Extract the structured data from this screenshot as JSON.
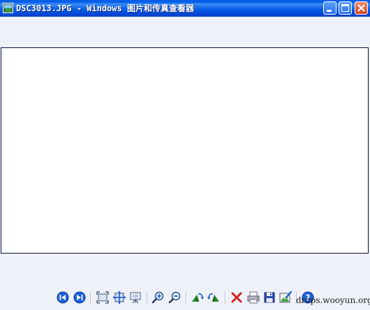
{
  "window": {
    "title": "DSC3013.JPG - Windows 图片和传真查看器"
  },
  "toolbar": {
    "buttons": [
      {
        "name": "previous-image",
        "icon": "previous-icon"
      },
      {
        "name": "next-image",
        "icon": "next-icon"
      },
      {
        "name": "best-fit",
        "icon": "best-fit-icon"
      },
      {
        "name": "actual-size",
        "icon": "actual-size-icon"
      },
      {
        "name": "slideshow",
        "icon": "slideshow-icon"
      },
      {
        "name": "zoom-in",
        "icon": "zoom-in-icon"
      },
      {
        "name": "zoom-out",
        "icon": "zoom-out-icon"
      },
      {
        "name": "rotate-clockwise",
        "icon": "rotate-clockwise-icon"
      },
      {
        "name": "rotate-counterclockwise",
        "icon": "rotate-counterclockwise-icon"
      },
      {
        "name": "delete",
        "icon": "delete-icon"
      },
      {
        "name": "print",
        "icon": "print-icon"
      },
      {
        "name": "save",
        "icon": "save-icon"
      },
      {
        "name": "edit",
        "icon": "edit-icon"
      },
      {
        "name": "help",
        "icon": "help-icon"
      }
    ]
  },
  "watermark": {
    "text": "drops.wooyun.org"
  },
  "colors": {
    "titlebar": "#0058e6",
    "content_bg": "#eef1f8",
    "image_bg": "#ffffff",
    "nav_blue": "#1c5fd8",
    "delete_red": "#d42020",
    "rotate_green": "#1f8a2a"
  }
}
